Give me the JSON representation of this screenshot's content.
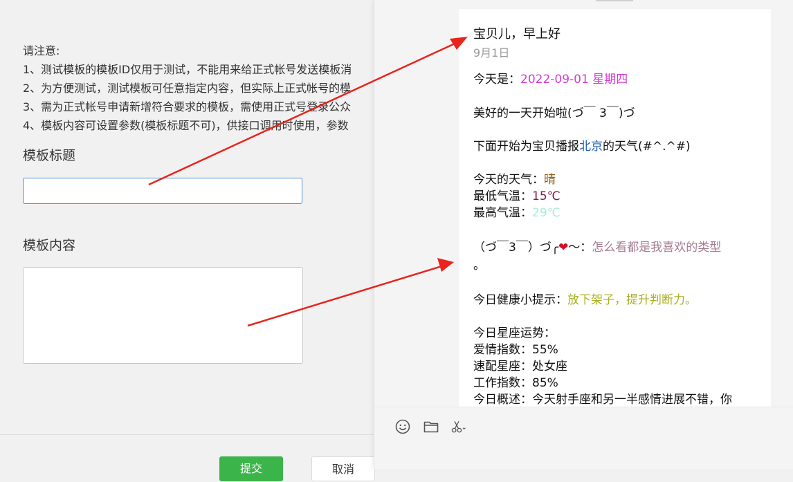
{
  "notice": {
    "heading": "请注意:",
    "items": [
      "1、测试模板的模板ID仅用于测试，不能用来给正式帐号发送模板消",
      "2、为方便测试，测试模板可任意指定内容，但实际上正式帐号的模",
      "3、需为正式帐号申请新增符合要求的模板，需使用正式号登录公众",
      "4、模板内容可设置参数(模板标题不可)，供接口调用时使用，参数"
    ]
  },
  "form": {
    "title_label": "模板标题",
    "title_value": "",
    "content_label": "模板内容",
    "content_value": "",
    "submit_label": "提交",
    "cancel_label": "取消"
  },
  "message": {
    "title": "宝贝儿，早上好",
    "date": "9月1日",
    "today_prefix": "今天是：",
    "today_value": "2022-09-01 星期四",
    "greeting": "美好的一天开始啦(づ￣ 3￣)づ",
    "weather_intro_prefix": "下面开始为宝贝播报",
    "weather_city": "北京",
    "weather_intro_suffix": "的天气(#^.^#)",
    "weather_label": "今天的天气：",
    "weather_value": "晴",
    "low_label": "最低气温：",
    "low_value": "15℃",
    "high_label": "最高气温：",
    "high_value": "29℃",
    "love_prefix": "（づ￣3￣）づ╭",
    "love_heart": "❤",
    "love_mid": "～：",
    "love_text": "怎么看都是我喜欢的类型",
    "love_end": "。",
    "health_label": "今日健康小提示：",
    "health_value": "放下架子，提升判断力。",
    "horoscope_label": "今日星座运势：",
    "love_index": "爱情指数：55%",
    "match_sign": "速配星座：处女座",
    "work_index": "工作指数：85%",
    "overview": "今日概述：今天射手座和另一半感情进展不错，你"
  },
  "toolbar": {
    "icons": [
      "emoji-icon",
      "folder-icon",
      "scissors-icon"
    ]
  },
  "colors": {
    "accent_green": "#3bb54a",
    "input_focus_blue": "#4a90d9",
    "arrow_red": "#e8241c",
    "date_magenta": "#d63bd1",
    "city_blue": "#1e5bb8"
  }
}
